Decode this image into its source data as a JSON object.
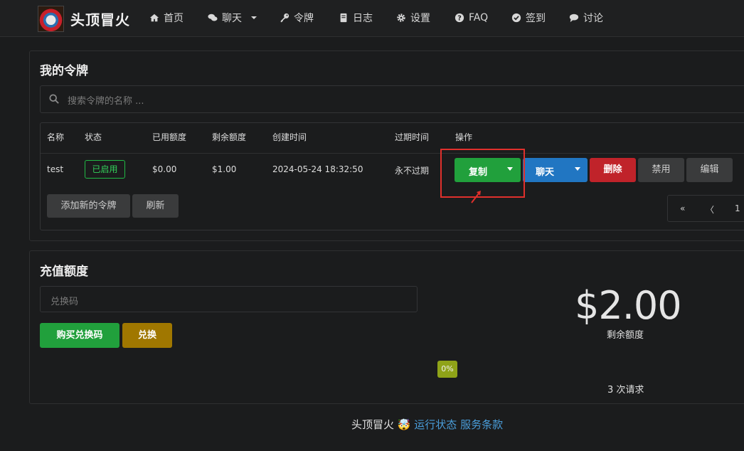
{
  "nav": {
    "brand": "头顶冒火",
    "items": [
      {
        "label": "首页",
        "icon": "home-icon"
      },
      {
        "label": "聊天",
        "icon": "chat-icon"
      },
      {
        "label": "令牌",
        "icon": "key-icon"
      },
      {
        "label": "日志",
        "icon": "book-icon"
      },
      {
        "label": "设置",
        "icon": "gear-icon"
      },
      {
        "label": "FAQ",
        "icon": "question-icon"
      },
      {
        "label": "签到",
        "icon": "check-circle-icon"
      },
      {
        "label": "讨论",
        "icon": "comment-icon"
      }
    ]
  },
  "tokens": {
    "title": "我的令牌",
    "search_placeholder": "搜索令牌的名称 ...",
    "columns": [
      "名称",
      "状态",
      "已用额度",
      "剩余额度",
      "创建时间",
      "过期时间",
      "操作"
    ],
    "rows": [
      {
        "name": "test",
        "status": "已启用",
        "used": "$0.00",
        "remaining": "$1.00",
        "created": "2024-05-24 18:32:50",
        "expires": "永不过期"
      }
    ],
    "actions": {
      "copy": "复制",
      "chat": "聊天",
      "delete": "删除",
      "disable": "禁用",
      "edit": "编辑"
    },
    "add_button": "添加新的令牌",
    "refresh_button": "刷新",
    "pager": {
      "first": "«",
      "prev": "〈",
      "page": "1"
    }
  },
  "recharge": {
    "title": "充值额度",
    "code_placeholder": "兑换码",
    "buy_button": "购买兑换码",
    "redeem_button": "兑换",
    "balance": "$2.00",
    "balance_label": "剩余额度",
    "progress": "0%",
    "requests": "3 次请求"
  },
  "footer": {
    "brand": "头顶冒火",
    "emoji": "🤯",
    "link_status": "运行状态",
    "link_terms": "服务条款"
  },
  "colors": {
    "green": "#21ba45",
    "blue": "#2185d0",
    "red": "#db2828",
    "gold": "#a07700",
    "highlight": "#e0302c"
  }
}
